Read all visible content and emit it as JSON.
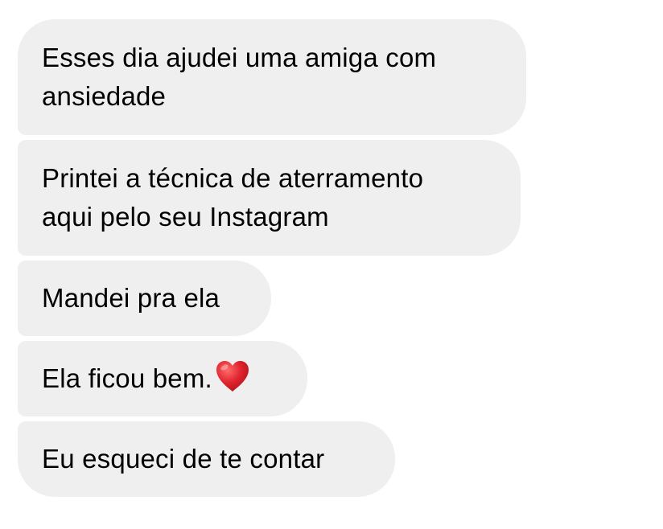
{
  "messages": [
    {
      "text": "Esses dia ajudei uma amiga com\nansiedade"
    },
    {
      "text": "Printei a técnica de aterramento\naqui pelo seu Instagram"
    },
    {
      "text": "Mandei pra ela"
    },
    {
      "text": "Ela ficou bem.",
      "emoji": "heart-icon"
    },
    {
      "text": "Eu esqueci de te contar"
    }
  ],
  "colors": {
    "bubble_background": "#efefef",
    "text": "#000000",
    "heart": "#e0232e"
  }
}
